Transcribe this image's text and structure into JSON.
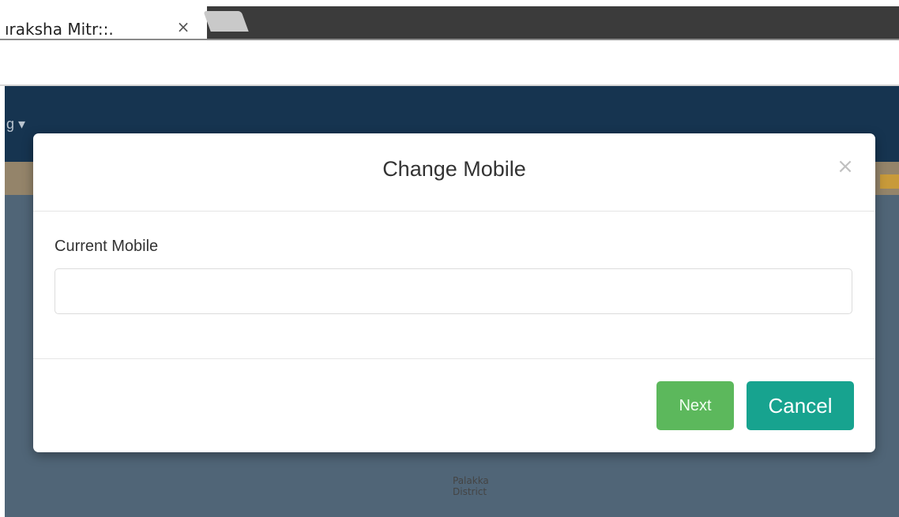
{
  "browser": {
    "tab_title": "ıraksha Mitr::.",
    "tab_close_glyph": "×"
  },
  "page": {
    "nav_fragment": "g ▾",
    "map_label_line1": "Palakka",
    "map_label_line2": "District"
  },
  "modal": {
    "title": "Change Mobile",
    "close_glyph": "×",
    "field_label": "Current Mobile",
    "field_value": "",
    "next_label": "Next",
    "cancel_label": "Cancel"
  },
  "colors": {
    "next_button": "#5cb85c",
    "cancel_button": "#17a38f",
    "navbar": "#163450"
  }
}
